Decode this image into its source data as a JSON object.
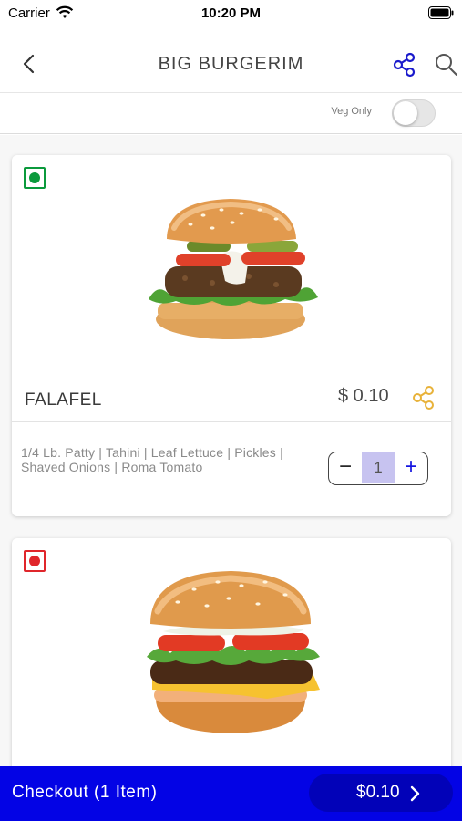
{
  "status_bar": {
    "carrier": "Carrier",
    "time": "10:20 PM",
    "icons": [
      "wifi-icon",
      "battery-icon"
    ]
  },
  "nav": {
    "title": "BIG BURGERIM",
    "icons": [
      "chevron-left-icon",
      "share-icon",
      "search-icon"
    ],
    "accent_color": "#1a1acc"
  },
  "filter": {
    "veg_only_label": "Veg Only",
    "veg_only_enabled": false
  },
  "items": [
    {
      "diet_type": "veg",
      "diet_color": "#0b9a3c",
      "image": "falafel-burger",
      "name": "FALAFEL",
      "price": "$ 0.10",
      "description": "1/4 Lb. Patty | Tahini | Leaf Lettuce | Pickles | Shaved Onions | Roma Tomato",
      "quantity": "1",
      "minus_label": "−",
      "plus_label": "+",
      "share_icon_color": "#e8b23a"
    },
    {
      "diet_type": "non-veg",
      "diet_color": "#e0262b",
      "image": "cheeseburger"
    }
  ],
  "checkout": {
    "label": "Checkout (1 Item)",
    "total": "$0.10",
    "bar_color": "#0303e5"
  }
}
